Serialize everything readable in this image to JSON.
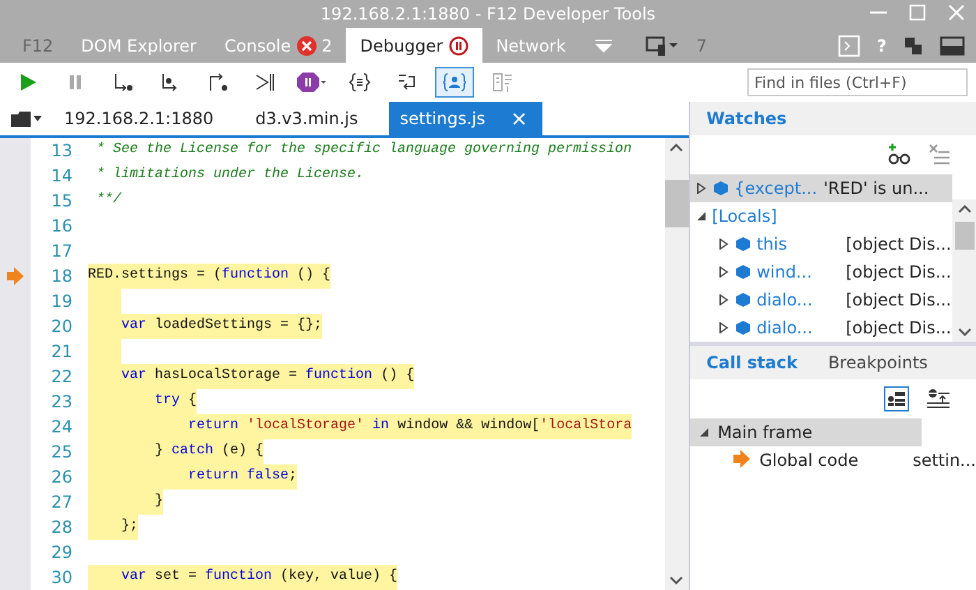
{
  "window": {
    "title": "192.168.2.1:1880 - F12 Developer Tools"
  },
  "tool_tabs": [
    {
      "label": "F12",
      "selected": false,
      "disabled": true
    },
    {
      "label": "DOM Explorer",
      "selected": false,
      "disabled": false
    },
    {
      "label": "Console",
      "selected": false,
      "disabled": false,
      "badge": "2"
    },
    {
      "label": "Debugger",
      "selected": true,
      "disabled": false,
      "paused": true
    },
    {
      "label": "Network",
      "selected": false,
      "disabled": false
    }
  ],
  "tool_tabs_right": {
    "emulation_count": "7",
    "help": "?"
  },
  "toolbar": {
    "buttons": [
      {
        "kind": "continue",
        "on": false
      },
      {
        "kind": "pause",
        "on": false
      },
      {
        "kind": "step_into",
        "on": false
      },
      {
        "kind": "step_over",
        "on": false
      },
      {
        "kind": "step_out",
        "on": false
      },
      {
        "kind": "break_worker",
        "on": false
      },
      {
        "kind": "exception",
        "on": false
      },
      {
        "kind": "pretty_print",
        "on": false
      },
      {
        "kind": "word_wrap",
        "on": false
      },
      {
        "kind": "just_my_code",
        "on": true
      },
      {
        "kind": "source_map",
        "on": false
      }
    ],
    "search": {
      "placeholder": "Find in files (Ctrl+F)"
    }
  },
  "file_tabs": [
    {
      "label": "192.168.2.1:1880",
      "selected": false
    },
    {
      "label": "d3.v3.min.js",
      "selected": false
    },
    {
      "label": "settings.js",
      "selected": true,
      "close": "×"
    }
  ],
  "code": {
    "lines": [
      {
        "number": "13",
        "highlighted": false,
        "current": false,
        "tokens": [
          {
            "kind": "comment",
            "text": " * See the License for the specific language governing permission"
          }
        ]
      },
      {
        "number": "14",
        "highlighted": false,
        "current": false,
        "tokens": [
          {
            "kind": "comment",
            "text": " * limitations under the License."
          }
        ]
      },
      {
        "number": "15",
        "highlighted": false,
        "current": false,
        "tokens": [
          {
            "kind": "comment",
            "text": " **/"
          }
        ]
      },
      {
        "number": "16",
        "highlighted": false,
        "current": false
      },
      {
        "number": "17",
        "highlighted": false,
        "current": false
      },
      {
        "number": "18",
        "highlighted": true,
        "current": true,
        "tokens": [
          {
            "kind": "plain",
            "text": "RED.settings = ("
          },
          {
            "kind": "keyword",
            "text": "function"
          },
          {
            "kind": "plain",
            "text": " () {"
          }
        ]
      },
      {
        "number": "19",
        "highlighted": true,
        "current": false
      },
      {
        "number": "20",
        "highlighted": true,
        "current": false,
        "tokens": [
          {
            "kind": "keyword",
            "text": "    var"
          },
          {
            "kind": "plain",
            "text": " loadedSettings = {};"
          }
        ]
      },
      {
        "number": "21",
        "highlighted": true,
        "current": false
      },
      {
        "number": "22",
        "highlighted": true,
        "current": false,
        "tokens": [
          {
            "kind": "keyword",
            "text": "    var"
          },
          {
            "kind": "plain",
            "text": " hasLocalStorage = "
          },
          {
            "kind": "keyword",
            "text": "function"
          },
          {
            "kind": "plain",
            "text": " () {"
          }
        ]
      },
      {
        "number": "23",
        "highlighted": true,
        "current": false,
        "tokens": [
          {
            "kind": "keyword",
            "text": "        try"
          },
          {
            "kind": "plain",
            "text": " {"
          }
        ]
      },
      {
        "number": "24",
        "highlighted": true,
        "current": false,
        "tokens": [
          {
            "kind": "keyword",
            "text": "            return"
          },
          {
            "kind": "string",
            "text": " 'localStorage'"
          },
          {
            "kind": "keyword",
            "text": " in"
          },
          {
            "kind": "plain",
            "text": " window && window["
          },
          {
            "kind": "string",
            "text": "'localStora"
          }
        ]
      },
      {
        "number": "25",
        "highlighted": true,
        "current": false,
        "tokens": [
          {
            "kind": "plain",
            "text": "        } "
          },
          {
            "kind": "keyword",
            "text": "catch"
          },
          {
            "kind": "plain",
            "text": " (e) {"
          }
        ]
      },
      {
        "number": "26",
        "highlighted": true,
        "current": false,
        "tokens": [
          {
            "kind": "keyword",
            "text": "            return false"
          },
          {
            "kind": "plain",
            "text": ";"
          }
        ]
      },
      {
        "number": "27",
        "highlighted": true,
        "current": false,
        "tokens": [
          {
            "kind": "plain",
            "text": "        }"
          }
        ]
      },
      {
        "number": "28",
        "highlighted": true,
        "current": false,
        "tokens": [
          {
            "kind": "plain",
            "text": "    };"
          }
        ]
      },
      {
        "number": "29",
        "highlighted": false,
        "current": false
      },
      {
        "number": "30",
        "highlighted": true,
        "current": false,
        "tokens": [
          {
            "kind": "keyword",
            "text": "    var"
          },
          {
            "kind": "plain",
            "text": " set = "
          },
          {
            "kind": "keyword",
            "text": "function"
          },
          {
            "kind": "plain",
            "text": " (key, value) {"
          }
        ]
      }
    ]
  },
  "watches": {
    "title": "Watches",
    "items": [
      {
        "name": "{except...",
        "value": "'RED' is un...",
        "expanded": false,
        "selected": true
      },
      {
        "name": "[Locals]",
        "expanded": true,
        "selected": false,
        "children": [
          {
            "name": "this",
            "value": "[object Dis...",
            "expanded": false,
            "selected": false
          },
          {
            "name": "wind...",
            "value": "[object Dis...",
            "expanded": false,
            "selected": false
          },
          {
            "name": "dialo...",
            "value": "[object Dis...",
            "expanded": false,
            "selected": false
          },
          {
            "name": "dialo...",
            "value": "[object Dis...",
            "expanded": false,
            "selected": false
          }
        ]
      }
    ]
  },
  "call_stack": {
    "tabs": [
      {
        "label": "Call stack",
        "selected": true
      },
      {
        "label": "Breakpoints",
        "selected": false
      }
    ],
    "frames": [
      {
        "name": "Main frame",
        "expanded": true,
        "children": [
          {
            "name": "Global code",
            "location": "settin...",
            "current": true
          }
        ]
      }
    ]
  }
}
